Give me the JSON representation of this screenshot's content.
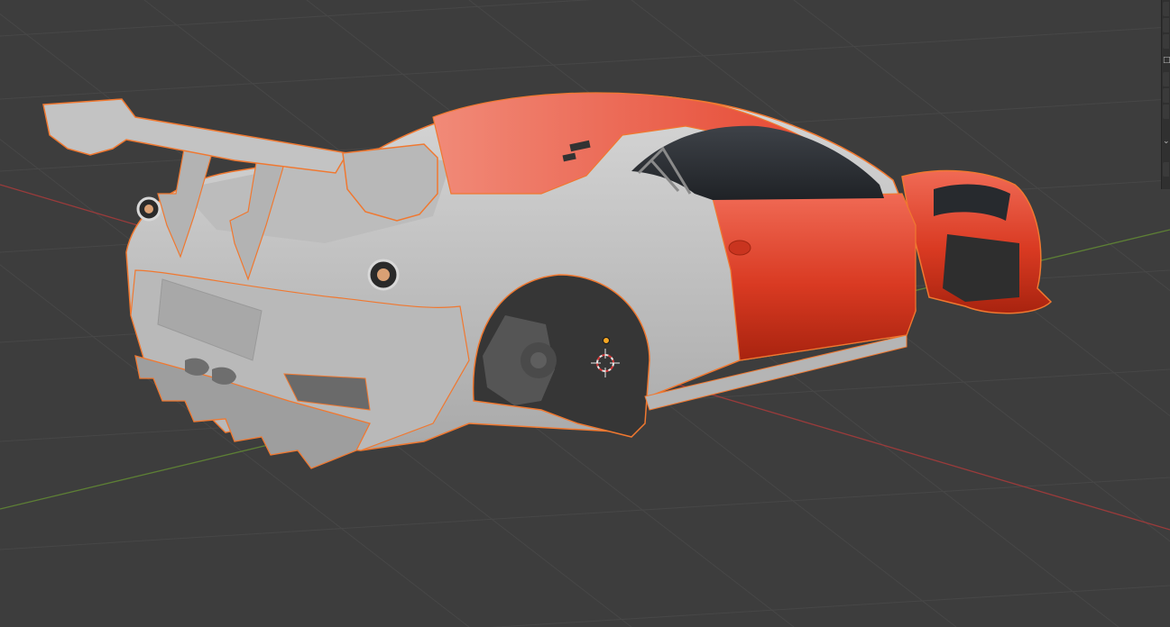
{
  "viewport": {
    "background": "#3d3d3d",
    "grid_color": "#454545",
    "x_axis_color": "#9a3b3b",
    "y_axis_color": "#5d7f35",
    "selection_outline": "#f07830",
    "body_color": "#c8c8c8",
    "paint_color": "#e0402a"
  },
  "icons": [
    "cursor-3d-icon",
    "object-origin-icon",
    "menu-glyph-icon",
    "chevron-down-icon"
  ],
  "side_strip": {
    "glyph_top": "□",
    "glyph_bottom": "⌄"
  }
}
